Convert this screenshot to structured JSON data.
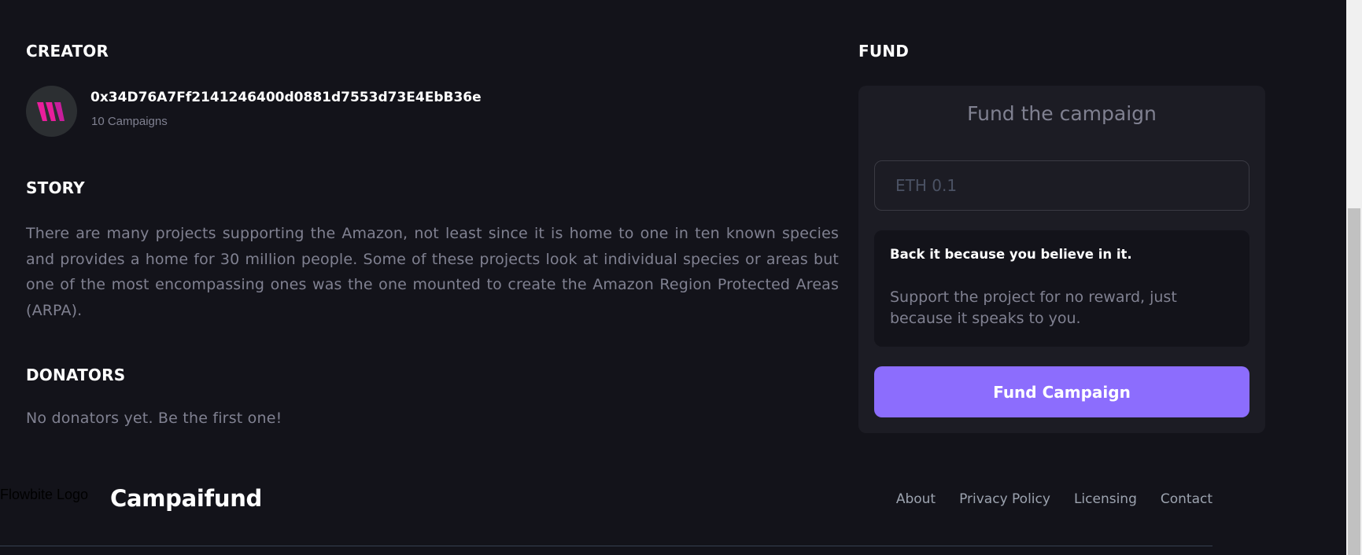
{
  "creator": {
    "heading": "CREATOR",
    "address": "0x34D76A7Ff2141246400d0881d7553d73E4EbB36e",
    "campaigns": "10 Campaigns",
    "avatar_icon": "campaifund-logo-icon",
    "avatar_color": "#e91e9c"
  },
  "story": {
    "heading": "STORY",
    "text": "There are many projects supporting the Amazon, not least since it is home to one in ten known species and provides a home for 30 million people. Some of these projects look at individual species or areas but one of the most encompassing ones was the one mounted to create the Amazon Region Protected Areas (ARPA)."
  },
  "donators": {
    "heading": "DONATORS",
    "empty_text": "No donators yet. Be the first one!"
  },
  "fund": {
    "heading": "FUND",
    "card_title": "Fund the campaign",
    "amount_value": "",
    "amount_placeholder": "ETH 0.1",
    "pitch_title": "Back it because you believe in it.",
    "pitch_text": "Support the project for no reward, just because it speaks to you.",
    "button_label": "Fund Campaign",
    "button_color": "#8c6dfd"
  },
  "footer": {
    "logo_alt": "Flowbite Logo",
    "brand": "Campaifund",
    "links": [
      "About",
      "Privacy Policy",
      "Licensing",
      "Contact"
    ]
  }
}
